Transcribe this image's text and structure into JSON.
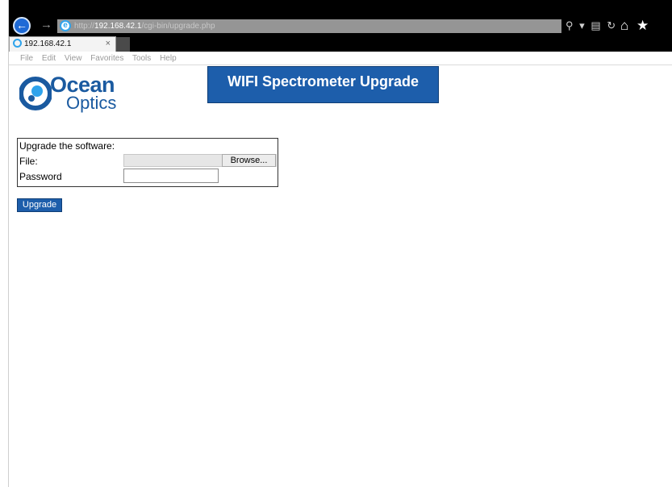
{
  "browser": {
    "back_glyph": "←",
    "forward_glyph": "→",
    "url_prefix": "http://",
    "url_host": "192.168.42.1",
    "url_path": "/cgi-bin/upgrade.php",
    "ie_glyph": "e",
    "search_glyph": "⚲",
    "dropdown_glyph": "▾",
    "compat_glyph": "▤",
    "refresh_glyph": "↻",
    "home_glyph": "⌂",
    "favorites_glyph": "★",
    "settings_glyph": "⚙",
    "tab_title": "192.168.42.1",
    "tab_close": "×"
  },
  "menu": {
    "file": "File",
    "edit": "Edit",
    "view": "View",
    "favorites": "Favorites",
    "tools": "Tools",
    "help": "Help"
  },
  "page": {
    "logo_word1": "Ocean",
    "logo_word2": "Optics",
    "banner_title": "WIFI Spectrometer Upgrade",
    "form_heading": "Upgrade the software:",
    "file_label": "File:",
    "browse_label": "Browse...",
    "password_label": "Password",
    "upgrade_label": "Upgrade"
  },
  "colors": {
    "brand_blue": "#1d5eab",
    "logo_blue": "#1a5aa0",
    "ie_blue": "#2ea3ec"
  }
}
